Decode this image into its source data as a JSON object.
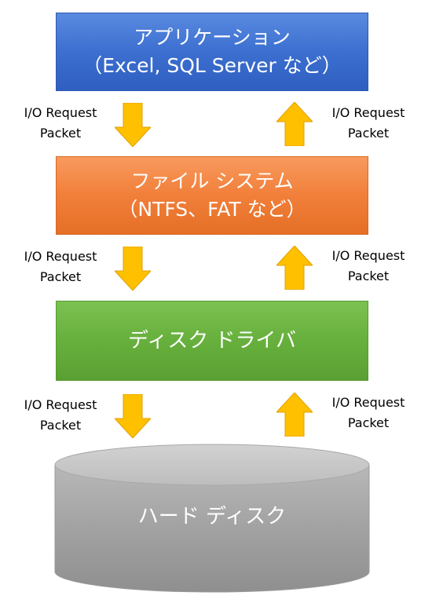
{
  "layers": {
    "application": {
      "line1": "アプリケーション",
      "line2": "（Excel, SQL Server など）",
      "color": "#4472C4"
    },
    "file_system": {
      "line1": "ファイル システム",
      "line2": "（NTFS、FAT など）",
      "color": "#ED7D31"
    },
    "disk_driver": {
      "line1": "ディスク ドライバ",
      "color": "#70AD47"
    },
    "hard_disk": {
      "line1": "ハード ディスク",
      "color": "#A5A5A5"
    }
  },
  "packets": {
    "row1": {
      "left": {
        "line1": "I/O Request",
        "line2": "Packet"
      },
      "right": {
        "line1": "I/O Request",
        "line2": "Packet"
      }
    },
    "row2": {
      "left": {
        "line1": "I/O Request",
        "line2": "Packet"
      },
      "right": {
        "line1": "I/O Request",
        "line2": "Packet"
      }
    },
    "row3": {
      "left": {
        "line1": "I/O Request",
        "line2": "Packet"
      },
      "right": {
        "line1": "I/O Request",
        "line2": "Packet"
      }
    }
  },
  "arrow_color": "#FFC000",
  "arrow_border_color": "#E0A000"
}
